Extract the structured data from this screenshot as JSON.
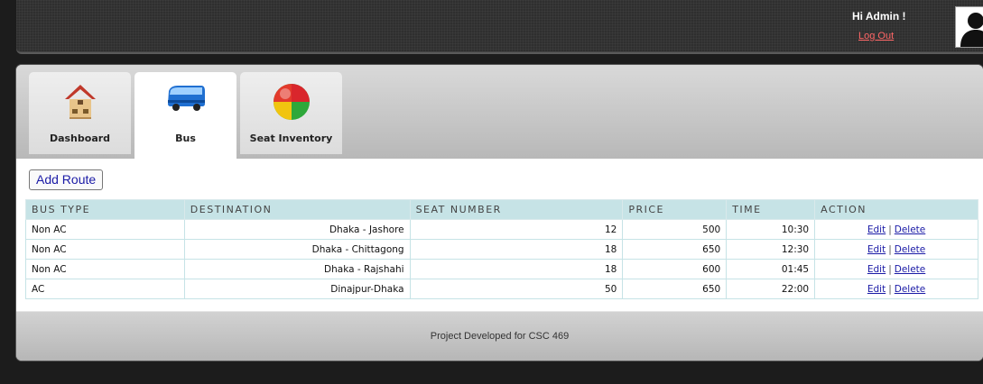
{
  "user": {
    "greeting": "Hi Admin !",
    "logout_label": "Log Out"
  },
  "nav": {
    "tabs": [
      {
        "label": "Dashboard",
        "icon": "house-icon",
        "active": false
      },
      {
        "label": "Bus",
        "icon": "bus-icon",
        "active": true
      },
      {
        "label": "Seat Inventory",
        "icon": "pie-chart-icon",
        "active": false
      }
    ]
  },
  "main": {
    "add_route_label": "Add Route",
    "table": {
      "headers": [
        "BUS TYPE",
        "DESTINATION",
        "SEAT NUMBER",
        "PRICE",
        "TIME",
        "ACTION"
      ],
      "rows": [
        {
          "bus_type": "Non AC",
          "destination": "Dhaka - Jashore",
          "seats": "12",
          "price": "500",
          "time": "10:30"
        },
        {
          "bus_type": "Non AC",
          "destination": "Dhaka - Chittagong",
          "seats": "18",
          "price": "650",
          "time": "12:30"
        },
        {
          "bus_type": "Non AC",
          "destination": "Dhaka - Rajshahi",
          "seats": "18",
          "price": "600",
          "time": "01:45"
        },
        {
          "bus_type": "AC",
          "destination": "Dinajpur-Dhaka",
          "seats": "50",
          "price": "650",
          "time": "22:00"
        }
      ],
      "edit_label": "Edit",
      "delete_label": "Delete",
      "separator": "|"
    }
  },
  "footer": {
    "text": "Project Developed for CSC 469"
  },
  "colors": {
    "header_bg": "#2f2f2f",
    "logout": "#ff6666",
    "table_header_bg": "#c6e3e6",
    "link": "#1a1aa6"
  }
}
